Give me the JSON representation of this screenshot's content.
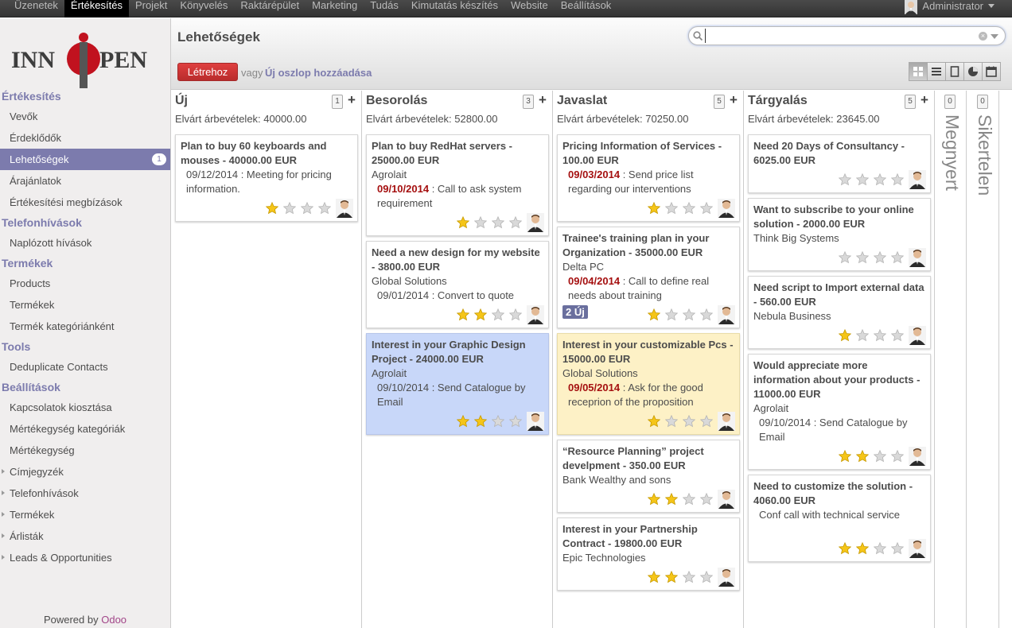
{
  "topbar": {
    "menu": [
      "Üzenetek",
      "Értékesítés",
      "Projekt",
      "Könyvelés",
      "Raktárépület",
      "Marketing",
      "Tudás",
      "Kimutatás készítés",
      "Website",
      "Beállítások"
    ],
    "active_index": 1,
    "user": "Administrator"
  },
  "logo": "INNOPEN",
  "sidebar": {
    "sections": [
      {
        "title": "Értékesítés",
        "items": [
          "Vevők",
          "Érdeklődők",
          "Lehetőségek",
          "Árajánlatok",
          "Értékesítési megbízások"
        ]
      },
      {
        "title": "Telefonhívások",
        "items": [
          "Naplózott hívások"
        ]
      },
      {
        "title": "Termékek",
        "items": [
          "Products",
          "Termékek",
          "Termék kategóriánként"
        ]
      },
      {
        "title": "Tools",
        "items": [
          "Deduplicate Contacts"
        ]
      },
      {
        "title": "Beállítások",
        "items": [
          "Kapcsolatok kiosztása",
          "Mértékegység kategóriák",
          "Mértékegység",
          "Címjegyzék",
          "Telefonhívások",
          "Termékek",
          "Árlisták",
          "Leads & Opportunities"
        ]
      }
    ],
    "active_item": "Lehetőségek",
    "active_badge": "1",
    "powered_prefix": "Powered by",
    "powered_brand": "Odoo"
  },
  "header": {
    "title": "Lehetőségek",
    "search_placeholder": "",
    "create_label": "Létrehoz",
    "or_label": "vagy",
    "add_column_label": "Új oszlop hozzáadása",
    "views": [
      "kanban-icon",
      "list-icon",
      "form-icon",
      "graph-icon",
      "calendar-icon"
    ]
  },
  "kanban": {
    "columns": [
      {
        "name": "Új",
        "count": "1",
        "expected": "Elvárt árbevételek: 40000.00",
        "cards": [
          {
            "title": "Plan to buy 60 keyboards and mouses - 40000.00 EUR",
            "partner": "",
            "date": "09/12/2014",
            "late": false,
            "activity": "Meeting for pricing information.",
            "stars": 1,
            "color": "white",
            "tag": ""
          }
        ]
      },
      {
        "name": "Besorolás",
        "count": "3",
        "expected": "Elvárt árbevételek: 52800.00",
        "cards": [
          {
            "title": "Plan to buy RedHat servers - 25000.00 EUR",
            "partner": "Agrolait",
            "date": "09/10/2014",
            "late": true,
            "activity": "Call to ask system requirement",
            "stars": 1,
            "color": "white",
            "tag": ""
          },
          {
            "title": "Need a new design for my website - 3800.00 EUR",
            "partner": "Global Solutions",
            "date": "09/01/2014",
            "late": false,
            "activity": "Convert to quote",
            "stars": 2,
            "color": "white",
            "tag": ""
          },
          {
            "title": "Interest in your Graphic Design Project - 24000.00 EUR",
            "partner": "Agrolait",
            "date": "09/10/2014",
            "late": false,
            "activity": "Send Catalogue by Email",
            "stars": 2,
            "color": "blue",
            "tag": ""
          }
        ]
      },
      {
        "name": "Javaslat",
        "count": "5",
        "expected": "Elvárt árbevételek: 70250.00",
        "cards": [
          {
            "title": "Pricing Information of Services - 100.00 EUR",
            "partner": "",
            "date": "09/03/2014",
            "late": true,
            "activity": "Send price list regarding our interventions",
            "stars": 1,
            "color": "white",
            "tag": ""
          },
          {
            "title": "Trainee's training plan in your Organization - 35000.00 EUR",
            "partner": "Delta PC",
            "date": "09/04/2014",
            "late": true,
            "activity": "Call to define real needs about training",
            "stars": 1,
            "color": "white",
            "tag": "2 Új"
          },
          {
            "title": "Interest in your customizable Pcs - 15000.00 EUR",
            "partner": "Global Solutions",
            "date": "09/05/2014",
            "late": true,
            "activity": "Ask for the good receprion of the proposition",
            "stars": 1,
            "color": "yellow",
            "tag": ""
          },
          {
            "title": "“Resource Planning” project develpment - 350.00 EUR",
            "partner": "Bank Wealthy and sons",
            "date": "",
            "late": false,
            "activity": "",
            "stars": 2,
            "color": "white",
            "tag": ""
          },
          {
            "title": "Interest in your Partnership Contract - 19800.00 EUR",
            "partner": "Epic Technologies",
            "date": "",
            "late": false,
            "activity": "",
            "stars": 2,
            "color": "white",
            "tag": ""
          }
        ]
      },
      {
        "name": "Tárgyalás",
        "count": "5",
        "expected": "Elvárt árbevételek: 23645.00",
        "cards": [
          {
            "title": "Need 20 Days of Consultancy - 6025.00 EUR",
            "partner": "",
            "date": "",
            "late": false,
            "activity": "",
            "stars": 0,
            "color": "white",
            "tag": ""
          },
          {
            "title": "Want to subscribe to your online solution - 2000.00 EUR",
            "partner": "Think Big Systems",
            "date": "",
            "late": false,
            "activity": "",
            "stars": 0,
            "color": "white",
            "tag": ""
          },
          {
            "title": "Need script to Import external data - 560.00 EUR",
            "partner": "Nebula Business",
            "date": "",
            "late": false,
            "activity": "",
            "stars": 1,
            "color": "white",
            "tag": ""
          },
          {
            "title": "Would appreciate more information about your products - 11000.00 EUR",
            "partner": "Agrolait",
            "date": "09/10/2014",
            "late": false,
            "activity": "Send Catalogue by Email",
            "stars": 2,
            "color": "white",
            "tag": ""
          },
          {
            "title": "Need to customize the solution - 4060.00 EUR",
            "partner": "",
            "date": "",
            "late": false,
            "activity": "Conf call with technical service",
            "stars": 2,
            "color": "white",
            "tag": ""
          }
        ]
      }
    ],
    "folded": [
      {
        "name": "Megnyert",
        "count": "0"
      },
      {
        "name": "Sikertelen",
        "count": "0"
      }
    ]
  },
  "colors": {
    "accent": "#7c7bad",
    "create": "#c52f2f",
    "late": "#a51010",
    "blue_card": "#c8d7f9",
    "yellow_card": "#fdf1c6"
  }
}
